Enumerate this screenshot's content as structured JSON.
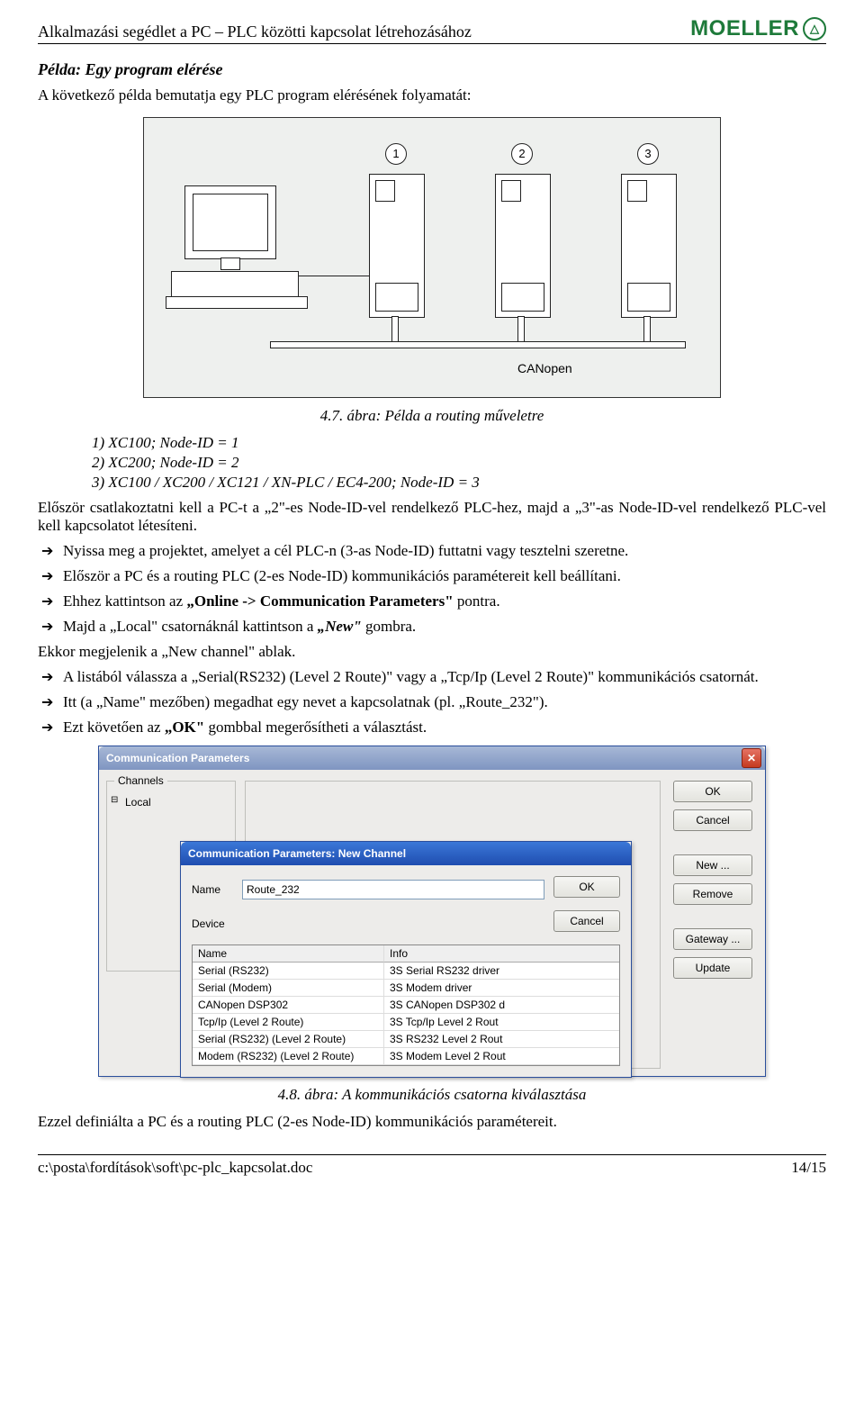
{
  "header": {
    "title": "Alkalmazási segédlet a PC – PLC közötti kapcsolat létrehozásához",
    "logo_text": "MOELLER",
    "logo_badge": "△"
  },
  "section": {
    "title": "Példa: Egy program elérése",
    "intro": "A következő példa bemutatja egy PLC program elérésének folyamatát:"
  },
  "fig47": {
    "caption": "4.7. ábra: Példa a routing műveletre",
    "labels": {
      "n1": "1",
      "n2": "2",
      "n3": "3",
      "bus": "CANopen"
    }
  },
  "list_nodes": {
    "l1": "1) XC100; Node-ID = 1",
    "l2": "2) XC200; Node-ID = 2",
    "l3": "3) XC100 / XC200 / XC121 / XN-PLC / EC4-200; Node-ID = 3"
  },
  "para_connect": "Először csatlakoztatni kell a PC-t a „2\"-es Node-ID-vel rendelkező PLC-hez, majd a „3\"-as Node-ID-vel rendelkező PLC-vel kell kapcsolatot létesíteni.",
  "bullets": {
    "b1": "Nyissa meg a projektet, amelyet a cél PLC-n (3-as Node-ID) futtatni vagy tesztelni szeretne.",
    "b2": "Először a PC és a routing PLC (2-es Node-ID) kommunikációs paramétereit kell beállítani.",
    "b3_pre": "Ehhez kattintson az ",
    "b3_bold": "„Online -> Communication Parameters\"",
    "b3_post": " pontra.",
    "b4_pre": "Majd a „Local\" csatornáknál kattintson a ",
    "b4_it": "„New\"",
    "b4_post": " gombra.",
    "after_b4": "Ekkor megjelenik a „New channel\" ablak.",
    "b5": "A listából válassza a „Serial(RS232) (Level 2 Route)\" vagy a „Tcp/Ip (Level 2 Route)\" kommunikációs csatornát.",
    "b6": "Itt (a „Name\" mezőben) megadhat egy nevet a kapcsolatnak (pl. „Route_232\").",
    "b7_pre": "Ezt követően az ",
    "b7_bold": "„OK\"",
    "b7_post": " gombbal megerősítheti a választást."
  },
  "outer_dialog": {
    "title": "Communication Parameters",
    "channels_legend": "Channels",
    "local_item": "Local",
    "buttons": {
      "ok": "OK",
      "cancel": "Cancel",
      "new": "New ...",
      "remove": "Remove",
      "gateway": "Gateway ...",
      "update": "Update"
    }
  },
  "inner_dialog": {
    "title": "Communication Parameters: New Channel",
    "name_lbl": "Name",
    "name_value": "Route_232",
    "device_lbl": "Device",
    "ok": "OK",
    "cancel": "Cancel",
    "columns": {
      "name": "Name",
      "info": "Info"
    },
    "rows": [
      {
        "name": "Serial (RS232)",
        "info": "3S Serial RS232 driver"
      },
      {
        "name": "Serial (Modem)",
        "info": "3S Modem driver"
      },
      {
        "name": "CANopen DSP302",
        "info": "3S CANopen DSP302 d"
      },
      {
        "name": "Tcp/Ip (Level 2 Route)",
        "info": "3S Tcp/Ip Level 2 Rout"
      },
      {
        "name": "Serial (RS232) (Level 2 Route)",
        "info": "3S RS232 Level 2 Rout"
      },
      {
        "name": "Modem (RS232) (Level 2 Route)",
        "info": "3S Modem Level 2 Rout"
      }
    ]
  },
  "fig48_caption": "4.8. ábra: A kommunikációs csatorna kiválasztása",
  "closing": "Ezzel definiálta a PC és a routing PLC (2-es Node-ID) kommunikációs paramétereit.",
  "footer": {
    "path": "c:\\posta\\fordítások\\soft\\pc-plc_kapcsolat.doc",
    "page": "14/15"
  }
}
